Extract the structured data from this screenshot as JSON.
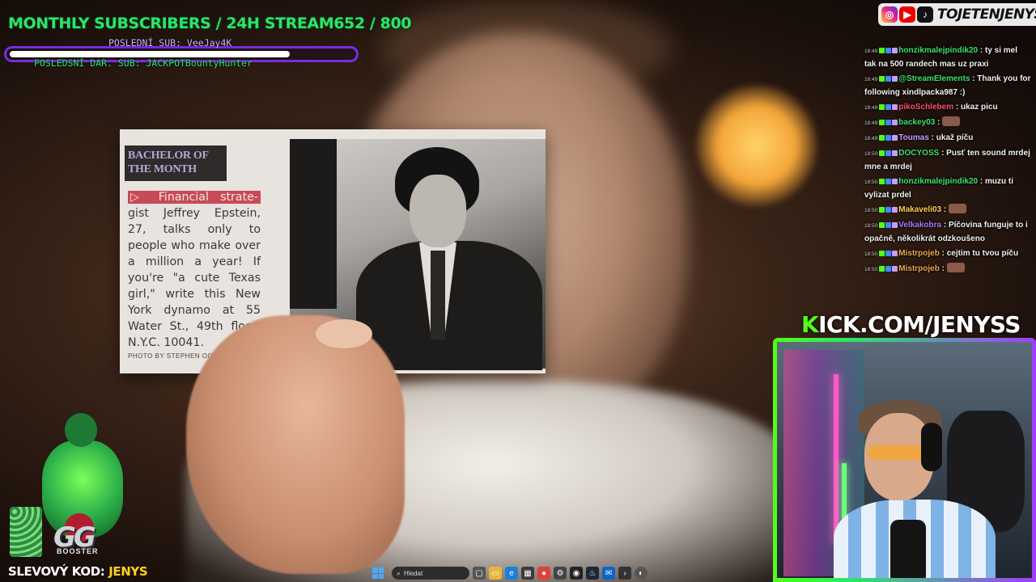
{
  "stream_overlay": {
    "subscriber_goal_title": "MONTHLY SUBSCRIBERS / 24H STREAM652 / 800",
    "goal_current": 652,
    "goal_target": 800,
    "last_sub": "POSLEDNÍ SUB: VeeJay4K",
    "last_donation": "POSLEDSNÍ DAR. SUB: JACKPOTBountyHunter",
    "bar_color": "#7a2be0",
    "title_color": "#2ee36b"
  },
  "social": {
    "icons": [
      "instagram-icon",
      "youtube-icon",
      "tiktok-icon"
    ],
    "handle": "TOJETENJENYS"
  },
  "video_content": {
    "card_heading": "BACHELOR OF THE MONTH",
    "card_highlight": "▷ Financial strate-",
    "card_body": "gist Jeffrey Epstein, 27, talks only to people who make over a million a year! If you're \"a cute Texas girl,\" write this New York dynamo at 55 Water St., 49th floor, N.Y.C. 10041.",
    "card_credit": "PHOTO BY STEPHEN OGILVY"
  },
  "chat": {
    "messages": [
      {
        "time": "18:49",
        "user": "honzikmalejpindik20",
        "user_color": "#39e36b",
        "text": ": ty si mel tak na 500 randech mas uz praxi"
      },
      {
        "time": "18:49",
        "user": "@StreamElements",
        "user_color": "#39e36b",
        "text": ": Thank you for following xindlpacka987 :)"
      },
      {
        "time": "18:49",
        "user": "pikoSchlebem",
        "user_color": "#ff4f6b",
        "text": ": ukaz picu"
      },
      {
        "time": "18:49",
        "user": "backey03",
        "user_color": "#39e36b",
        "text": ":",
        "emote": true
      },
      {
        "time": "18:49",
        "user": "Toumas",
        "user_color": "#c99bff",
        "text": ": ukaž píču"
      },
      {
        "time": "18:50",
        "user": "DOCYOSS",
        "user_color": "#39e36b",
        "text": ": Pusť ten sound mrdej mne a mrdej"
      },
      {
        "time": "18:50",
        "user": "honzikmalejpindik20",
        "user_color": "#39e36b",
        "text": ": muzu ti vylizat prdel"
      },
      {
        "time": "18:50",
        "user": "Makaveli03",
        "user_color": "#ffd24a",
        "text": ":",
        "emote": true
      },
      {
        "time": "18:50",
        "user": "Velkakobra",
        "user_color": "#a57bff",
        "text": ": Píčovina funguje to i opačně, několikrát odzkoušeno"
      },
      {
        "time": "18:50",
        "user": "Mistrpojeb",
        "user_color": "#f0a64a",
        "text": ": cejtim tu tvou píču"
      },
      {
        "time": "18:50",
        "user": "Mistrpojeb",
        "user_color": "#f0a64a",
        "text": ":",
        "emote": true
      }
    ]
  },
  "kick": {
    "prefix": "K",
    "rest": "ICK.COM/JENYSS"
  },
  "promo": {
    "label": "SLEVOVÝ KOD:",
    "code": "JENYS",
    "brand": "GG",
    "brand_sub": "BOOSTER"
  },
  "taskbar": {
    "search_placeholder": "Hledat",
    "apps": [
      "start-icon",
      "task-view-icon",
      "file-explorer-icon",
      "edge-icon",
      "store-icon",
      "chrome-icon",
      "settings-icon",
      "github-icon",
      "steam-icon",
      "mail-icon",
      "terminal-icon",
      "obs-icon"
    ]
  }
}
